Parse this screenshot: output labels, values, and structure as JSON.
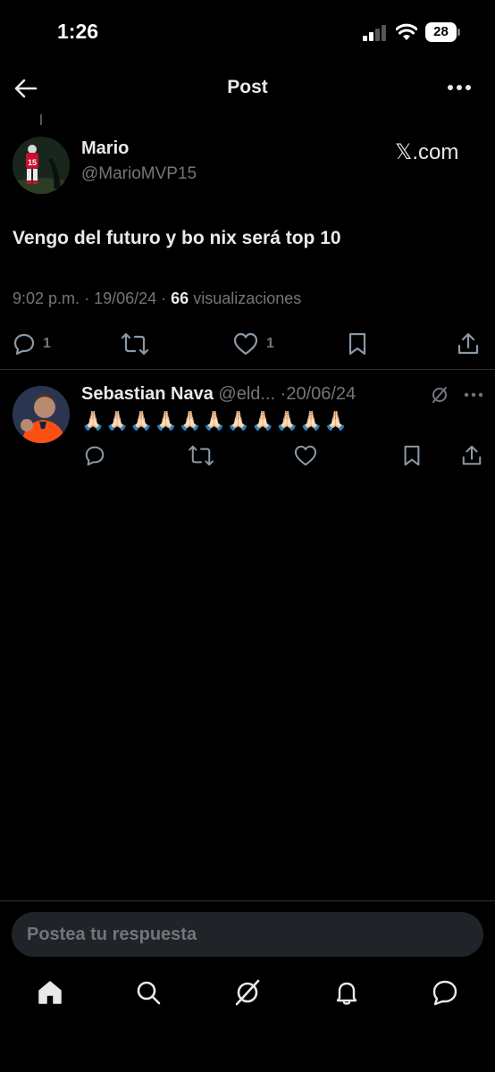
{
  "status_bar": {
    "time": "1:26",
    "battery": "28"
  },
  "header": {
    "title": "Post",
    "back_icon": "arrow-left-icon",
    "more_icon": "ellipsis-icon"
  },
  "post": {
    "author_name": "Mario",
    "author_handle": "@MarioMVP15",
    "source": "𝕏.com",
    "text": "Vengo del futuro y bo nix será top 10",
    "time": "9:02 p.m.",
    "date": "19/06/24",
    "views_count": "66",
    "views_label": "visualizaciones",
    "reply_count": "1",
    "like_count": "1"
  },
  "reply": {
    "name": "Sebastian Nava",
    "handle": "@eld...",
    "separator": "·",
    "date": "20/06/24",
    "text": "🙏🏻🙏🏻🙏🏻🙏🏻🙏🏻🙏🏻🙏🏻🙏🏻🙏🏻🙏🏻🙏🏻"
  },
  "composer": {
    "placeholder": "Postea tu respuesta"
  },
  "tabs": [
    "home-icon",
    "search-icon",
    "grok-icon",
    "notifications-icon",
    "messages-icon"
  ],
  "colors": {
    "background": "#000000",
    "text": "#e7e9ea",
    "muted": "#71767b",
    "divider": "#2f3336",
    "input_bg": "#202327"
  }
}
